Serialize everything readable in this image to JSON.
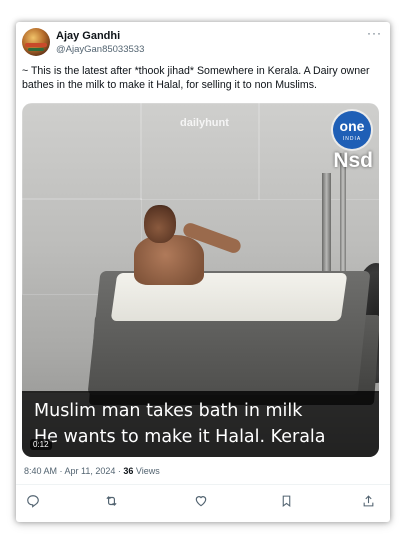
{
  "tweet": {
    "author_name": "Ajay Gandhi",
    "author_handle": "@AjayGan85033533",
    "text": "~ This is the latest after *thook jihad*  Somewhere in Kerala. A Dairy owner bathes in the milk to make it Halal, for selling it to non Muslims.",
    "more_icon": "more-horizontal-icon",
    "timestamp": "8:40 AM · Apr 11, 2024 · ",
    "views_count": "36",
    "views_label": " Views"
  },
  "video": {
    "watermark_text": "dailyhunt",
    "channel_logo_top": "one",
    "channel_logo_bottom": "INDIA",
    "channel_code": "Nsd",
    "caption_line1": "Muslim man takes bath in milk",
    "caption_line2": "He wants to make it Halal. Kerala",
    "duration": "0:12"
  },
  "actions": {
    "reply_icon": "reply-icon",
    "retweet_icon": "retweet-icon",
    "like_icon": "like-icon",
    "bookmark_icon": "bookmark-icon",
    "share_icon": "share-icon"
  },
  "colors": {
    "text_primary": "#0f1419",
    "text_secondary": "#536471",
    "caption_background": "#000000",
    "logo_blue": "#1f5fb6"
  }
}
